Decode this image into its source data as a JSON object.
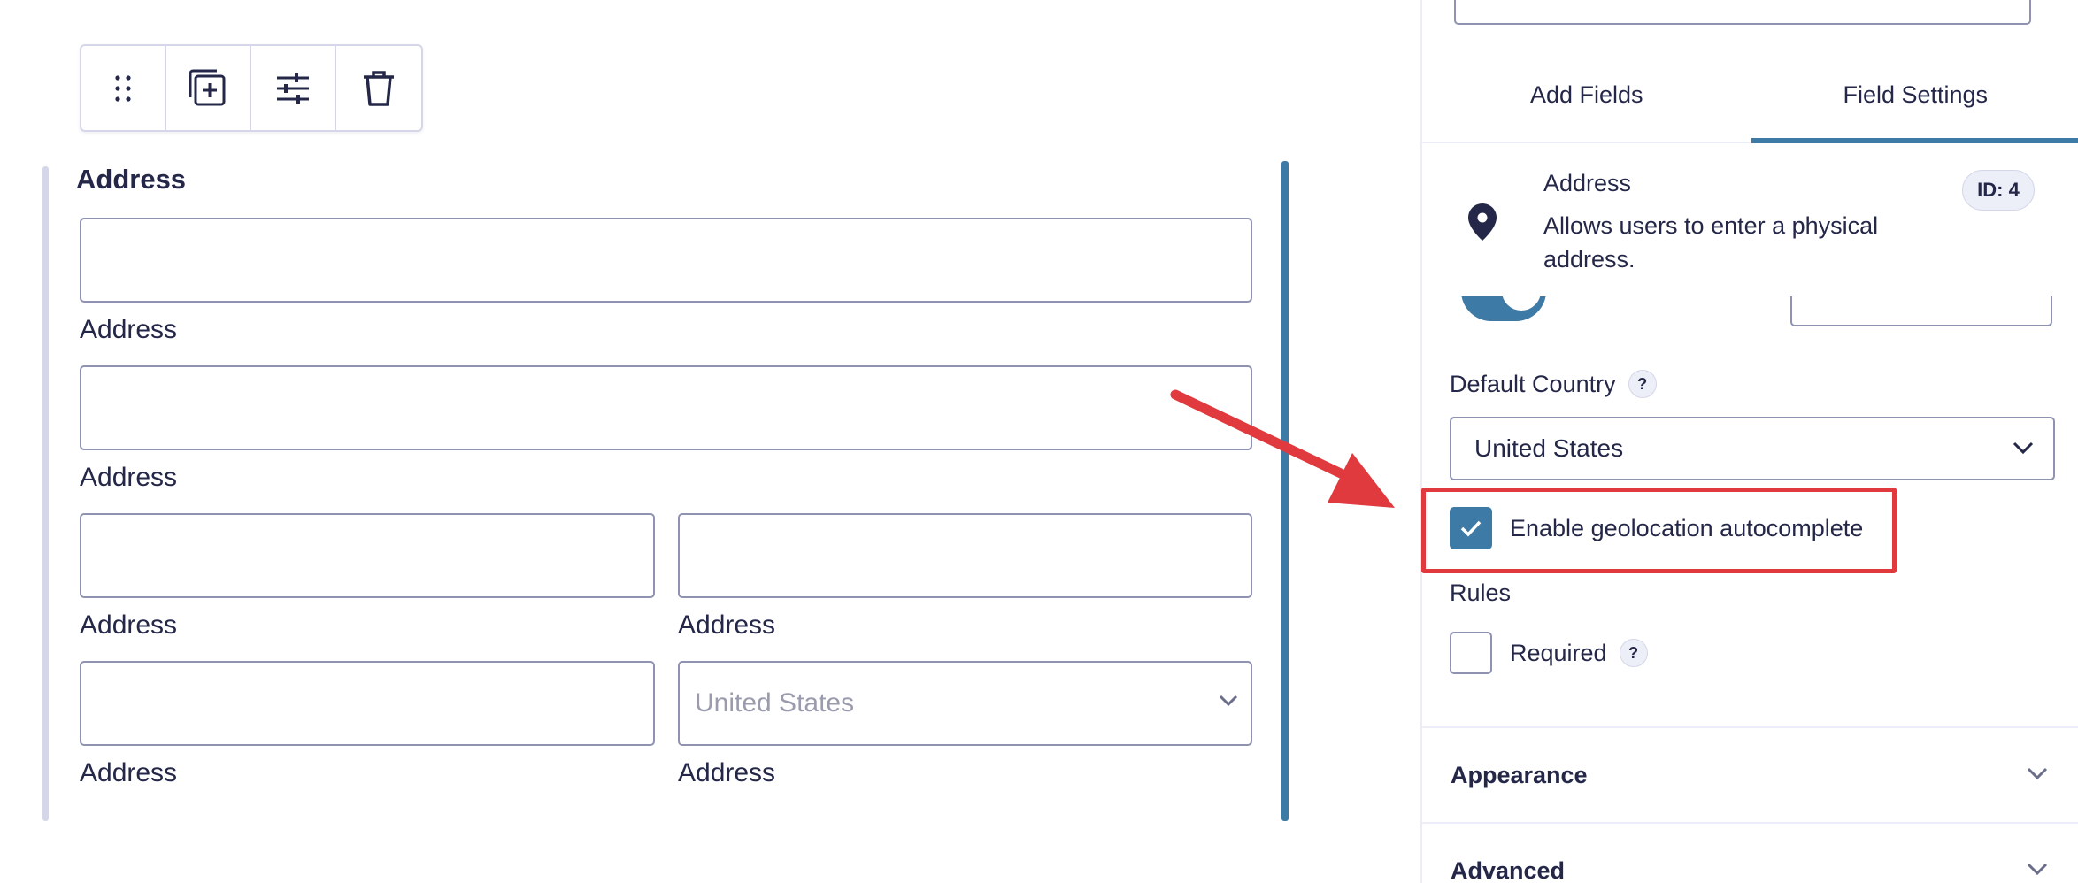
{
  "editor": {
    "toolbar": {
      "drag_icon": "drag-handle-icon",
      "duplicate_icon": "duplicate-icon",
      "settings_icon": "sliders-icon",
      "delete_icon": "trash-icon"
    },
    "field_title": "Address",
    "sub_labels": [
      "Address",
      "Address",
      "Address",
      "Address",
      "Address",
      "Address"
    ],
    "country_placeholder": "United States"
  },
  "panel": {
    "tabs": [
      {
        "label": "Add Fields",
        "active": false
      },
      {
        "label": "Field Settings",
        "active": true
      }
    ],
    "field_info": {
      "title": "Address",
      "description": "Allows users to enter a physical address.",
      "id_badge": "ID: 4",
      "icon": "map-pin-icon"
    },
    "default_country": {
      "label": "Default Country",
      "help": "?",
      "value": "United States"
    },
    "geolocation": {
      "label": "Enable geolocation autocomplete",
      "checked": true
    },
    "rules": {
      "label": "Rules",
      "required_label": "Required",
      "required_checked": false,
      "help": "?"
    },
    "sections": [
      "Appearance",
      "Advanced"
    ]
  },
  "colors": {
    "accent": "#3e7aa6",
    "highlight": "#e0393e",
    "text": "#242748",
    "border": "#9092b2"
  }
}
